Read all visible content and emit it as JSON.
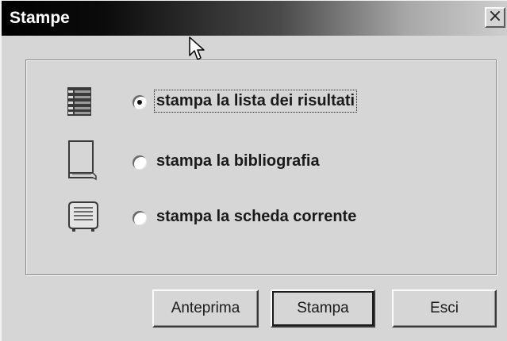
{
  "window": {
    "title": "Stampe",
    "close_label": "×"
  },
  "options": [
    {
      "label": "stampa la lista dei risultati",
      "icon": "list-icon",
      "selected": true
    },
    {
      "label": "stampa la bibliografia",
      "icon": "book-icon",
      "selected": false
    },
    {
      "label": "stampa la scheda corrente",
      "icon": "card-icon",
      "selected": false
    }
  ],
  "buttons": {
    "preview": "Anteprima",
    "print": "Stampa",
    "exit": "Esci"
  }
}
